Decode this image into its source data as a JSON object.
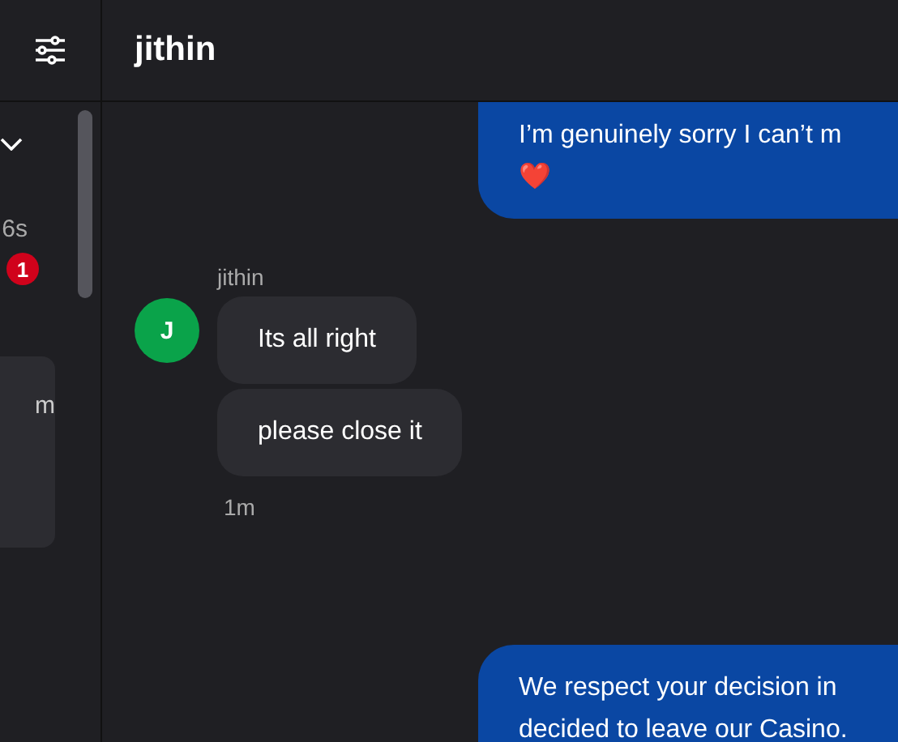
{
  "sidebar": {
    "time": "6s",
    "unread_badge": "1",
    "card_time": "m"
  },
  "header": {
    "title": "jithin"
  },
  "messages": [
    {
      "kind": "outgoing",
      "lines": [
        "I’m genuinely sorry I can’t m"
      ],
      "emoji": "❤️"
    },
    {
      "kind": "incoming",
      "sender": "jithin",
      "avatar": "J",
      "bubbles": [
        "Its all right",
        "please close it"
      ],
      "time": "1m"
    },
    {
      "kind": "outgoing",
      "lines": [
        "We respect your decision in",
        "decided to leave our Casino."
      ]
    }
  ]
}
